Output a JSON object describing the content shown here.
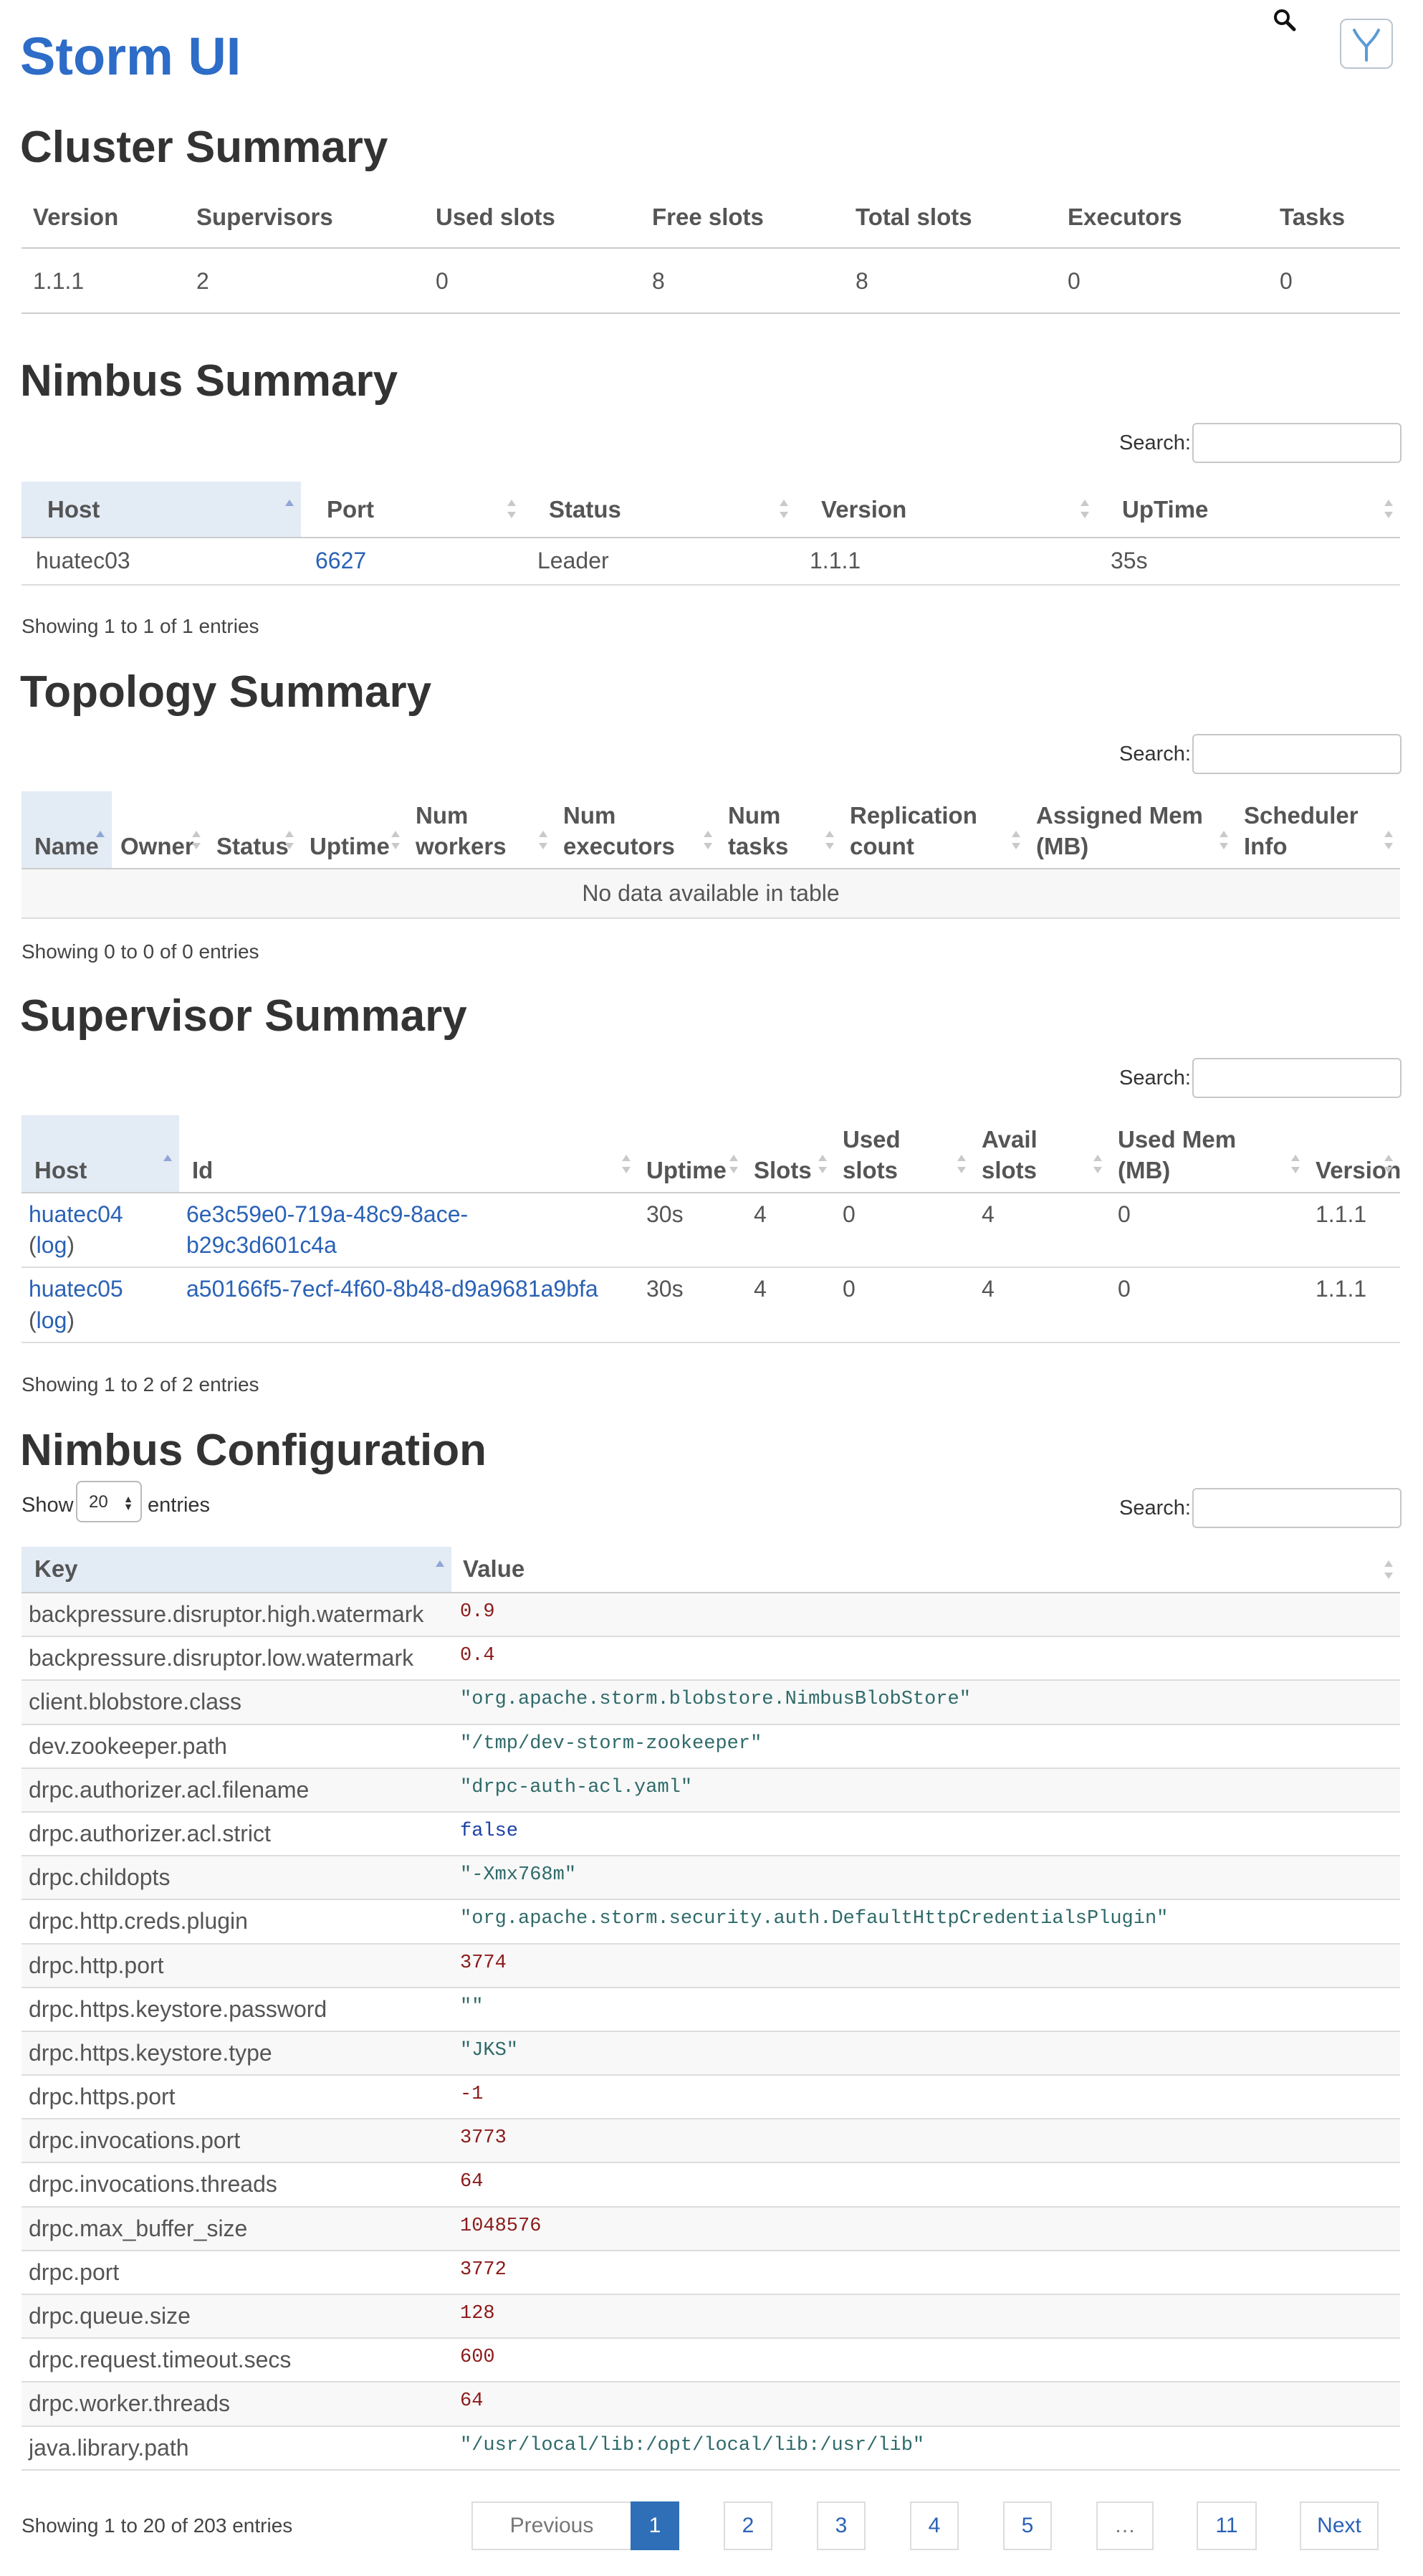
{
  "app": {
    "title": "Storm UI"
  },
  "cluster": {
    "title": "Cluster Summary",
    "headers": [
      "Version",
      "Supervisors",
      "Used slots",
      "Free slots",
      "Total slots",
      "Executors",
      "Tasks"
    ],
    "row": [
      "1.1.1",
      "2",
      "0",
      "8",
      "8",
      "0",
      "0"
    ]
  },
  "nimbus": {
    "title": "Nimbus Summary",
    "search_label": "Search:",
    "headers": [
      "Host",
      "Port",
      "Status",
      "Version",
      "UpTime"
    ],
    "row": {
      "host": "huatec03",
      "port": "6627",
      "status": "Leader",
      "version": "1.1.1",
      "uptime": "35s"
    },
    "info": "Showing 1 to 1 of 1 entries"
  },
  "topology": {
    "title": "Topology Summary",
    "search_label": "Search:",
    "headers": [
      "Name",
      "Owner",
      "Status",
      "Uptime",
      "Num workers",
      "Num executors",
      "Num tasks",
      "Replication count",
      "Assigned Mem (MB)",
      "Scheduler Info"
    ],
    "empty": "No data available in table",
    "info": "Showing 0 to 0 of 0 entries"
  },
  "supervisor": {
    "title": "Supervisor Summary",
    "search_label": "Search:",
    "headers": [
      "Host",
      "Id",
      "Uptime",
      "Slots",
      "Used slots",
      "Avail slots",
      "Used Mem (MB)",
      "Version"
    ],
    "log_label": "log",
    "rows": [
      {
        "host": "huatec04",
        "id": "6e3c59e0-719a-48c9-8ace-b29c3d601c4a",
        "uptime": "30s",
        "slots": "4",
        "used": "0",
        "avail": "4",
        "mem": "0",
        "version": "1.1.1"
      },
      {
        "host": "huatec05",
        "id": "a50166f5-7ecf-4f60-8b48-d9a9681a9bfa",
        "uptime": "30s",
        "slots": "4",
        "used": "0",
        "avail": "4",
        "mem": "0",
        "version": "1.1.1"
      }
    ],
    "info": "Showing 1 to 2 of 2 entries"
  },
  "config": {
    "title": "Nimbus Configuration",
    "show_label": "Show",
    "show_value": "20",
    "entries_label": "entries",
    "search_label": "Search:",
    "headers": [
      "Key",
      "Value"
    ],
    "rows": [
      {
        "key": "backpressure.disruptor.high.watermark",
        "value": "0.9",
        "type": "num"
      },
      {
        "key": "backpressure.disruptor.low.watermark",
        "value": "0.4",
        "type": "num"
      },
      {
        "key": "client.blobstore.class",
        "value": "\"org.apache.storm.blobstore.NimbusBlobStore\"",
        "type": "str"
      },
      {
        "key": "dev.zookeeper.path",
        "value": "\"/tmp/dev-storm-zookeeper\"",
        "type": "str"
      },
      {
        "key": "drpc.authorizer.acl.filename",
        "value": "\"drpc-auth-acl.yaml\"",
        "type": "str"
      },
      {
        "key": "drpc.authorizer.acl.strict",
        "value": "false",
        "type": "bool"
      },
      {
        "key": "drpc.childopts",
        "value": "\"-Xmx768m\"",
        "type": "str"
      },
      {
        "key": "drpc.http.creds.plugin",
        "value": "\"org.apache.storm.security.auth.DefaultHttpCredentialsPlugin\"",
        "type": "str"
      },
      {
        "key": "drpc.http.port",
        "value": "3774",
        "type": "num"
      },
      {
        "key": "drpc.https.keystore.password",
        "value": "\"\"",
        "type": "str"
      },
      {
        "key": "drpc.https.keystore.type",
        "value": "\"JKS\"",
        "type": "str"
      },
      {
        "key": "drpc.https.port",
        "value": "-1",
        "type": "num"
      },
      {
        "key": "drpc.invocations.port",
        "value": "3773",
        "type": "num"
      },
      {
        "key": "drpc.invocations.threads",
        "value": "64",
        "type": "num"
      },
      {
        "key": "drpc.max_buffer_size",
        "value": "1048576",
        "type": "num"
      },
      {
        "key": "drpc.port",
        "value": "3772",
        "type": "num"
      },
      {
        "key": "drpc.queue.size",
        "value": "128",
        "type": "num"
      },
      {
        "key": "drpc.request.timeout.secs",
        "value": "600",
        "type": "num"
      },
      {
        "key": "drpc.worker.threads",
        "value": "64",
        "type": "num"
      },
      {
        "key": "java.library.path",
        "value": "\"/usr/local/lib:/opt/local/lib:/usr/lib\"",
        "type": "str"
      }
    ],
    "info": "Showing 1 to 20 of 203 entries",
    "pagination": {
      "previous": "Previous",
      "pages": [
        "1",
        "2",
        "3",
        "4",
        "5",
        "…",
        "11"
      ],
      "active": "1",
      "next": "Next"
    }
  },
  "colors": {
    "brand": "#2d6cc7",
    "link": "#2a62b6",
    "active_page": "#2f6fb8",
    "sorted_header": "#e3ebf5"
  }
}
